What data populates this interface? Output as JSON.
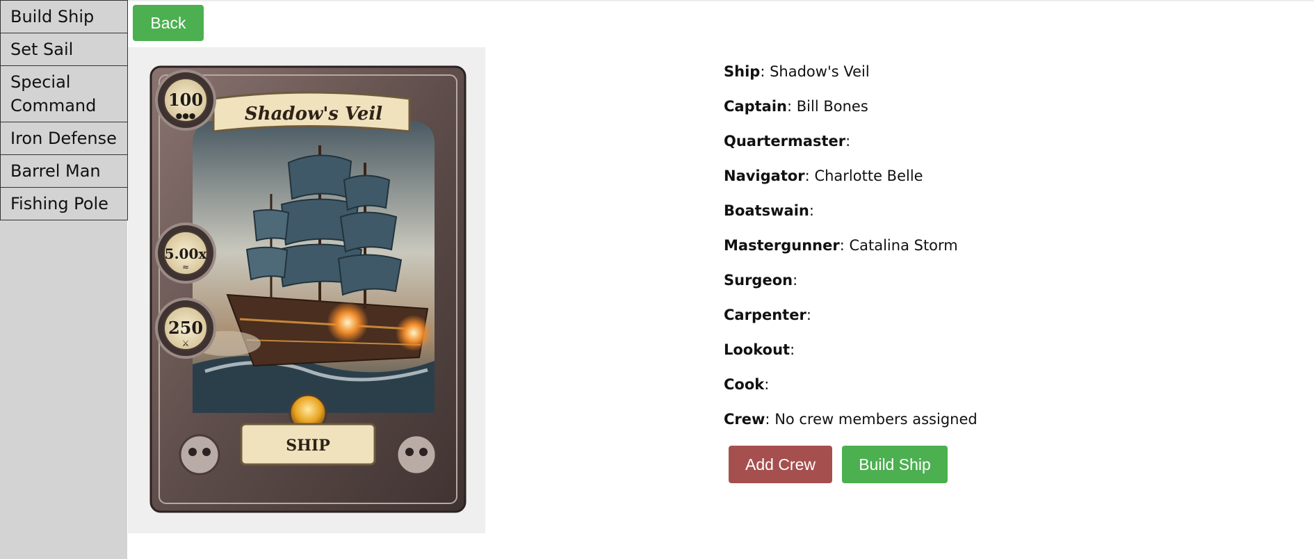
{
  "sidebar": {
    "items": [
      {
        "label": "Build Ship"
      },
      {
        "label": "Set Sail"
      },
      {
        "label": "Special Command"
      },
      {
        "label": "Iron Defense"
      },
      {
        "label": "Barrel Man"
      },
      {
        "label": "Fishing Pole"
      }
    ]
  },
  "back_label": "Back",
  "card": {
    "title": "Shadow's Veil",
    "type": "SHIP",
    "stats": {
      "top": "100",
      "middle": "5.00x",
      "bottom": "250"
    },
    "colors": {
      "frame": "#6b5a55",
      "parchment": "#efe2bd",
      "sky": "#8e9aa3",
      "sail": "#3f5968",
      "fire": "#ef8a2a"
    }
  },
  "details": {
    "rows": [
      {
        "label": "Ship",
        "value": "Shadow's Veil"
      },
      {
        "label": "Captain",
        "value": "Bill Bones"
      },
      {
        "label": "Quartermaster",
        "value": ""
      },
      {
        "label": "Navigator",
        "value": "Charlotte Belle"
      },
      {
        "label": "Boatswain",
        "value": ""
      },
      {
        "label": "Mastergunner",
        "value": "Catalina Storm"
      },
      {
        "label": "Surgeon",
        "value": ""
      },
      {
        "label": "Carpenter",
        "value": ""
      },
      {
        "label": "Lookout",
        "value": ""
      },
      {
        "label": "Cook",
        "value": ""
      },
      {
        "label": "Crew",
        "value": "No crew members assigned"
      }
    ]
  },
  "actions": {
    "add_crew": "Add Crew",
    "build_ship": "Build Ship"
  },
  "colors": {
    "sidebar_bg": "#d3d3d3",
    "green_button": "#4caf50",
    "red_button": "#a64f4f",
    "panel_bg": "#efefef"
  }
}
